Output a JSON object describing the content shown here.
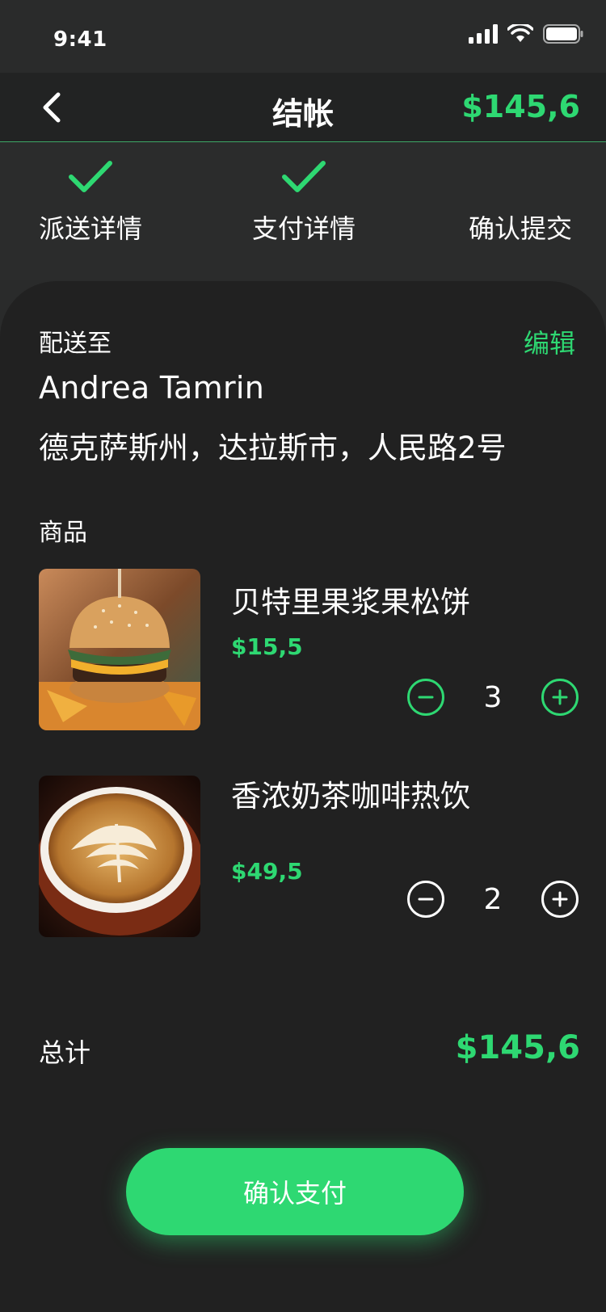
{
  "status_bar": {
    "time": "9:41"
  },
  "header": {
    "title": "结帐",
    "total": "$145,6"
  },
  "steps": [
    {
      "label": "派送详情",
      "done": true
    },
    {
      "label": "支付详情",
      "done": true
    },
    {
      "label": "确认提交",
      "done": false
    }
  ],
  "shipping": {
    "label": "配送至",
    "edit_label": "编辑",
    "name": "Andrea Tamrin",
    "address": "德克萨斯州，达拉斯市，人民路2号"
  },
  "products": {
    "label": "商品",
    "items": [
      {
        "name": "贝特里果浆果松饼",
        "price": "$15,5",
        "quantity": "3",
        "image": "burger-photo"
      },
      {
        "name": "香浓奶茶咖啡热饮",
        "price": "$49,5",
        "quantity": "2",
        "image": "latte-photo"
      }
    ]
  },
  "summary": {
    "label": "总计",
    "total": "$145,6"
  },
  "confirm_button": {
    "label": "确认支付"
  },
  "colors": {
    "accent": "#2ed872",
    "background": "#212121"
  }
}
